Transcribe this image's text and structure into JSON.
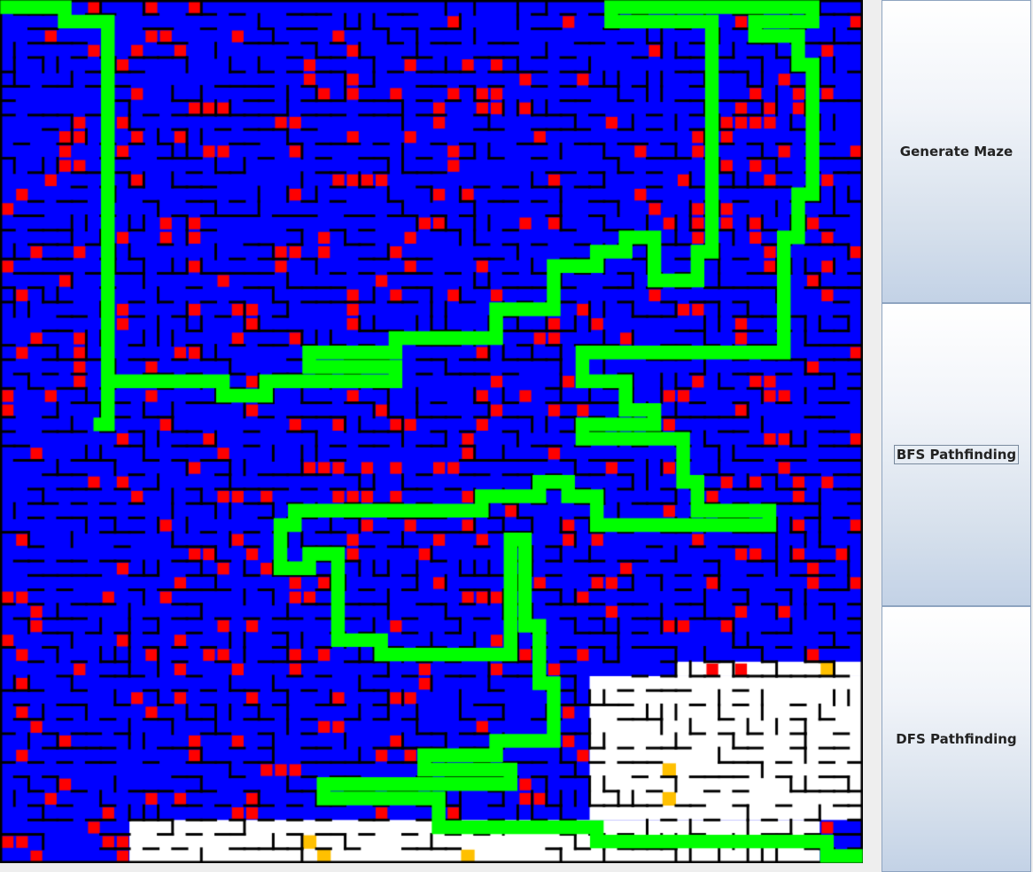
{
  "app": {
    "buttons": [
      {
        "label": "Generate Maze",
        "focused": false
      },
      {
        "label": "BFS Pathfinding",
        "focused": true
      },
      {
        "label": "DFS Pathfinding",
        "focused": false
      }
    ]
  },
  "maze": {
    "grid_size": 60,
    "colors": {
      "passage": "#0000ff",
      "wall": "#000000",
      "visited": "#ff0000",
      "path": "#00ff00",
      "unvisited": "#ffffff",
      "frontier": "#ffc000"
    },
    "seed": 20240613
  }
}
